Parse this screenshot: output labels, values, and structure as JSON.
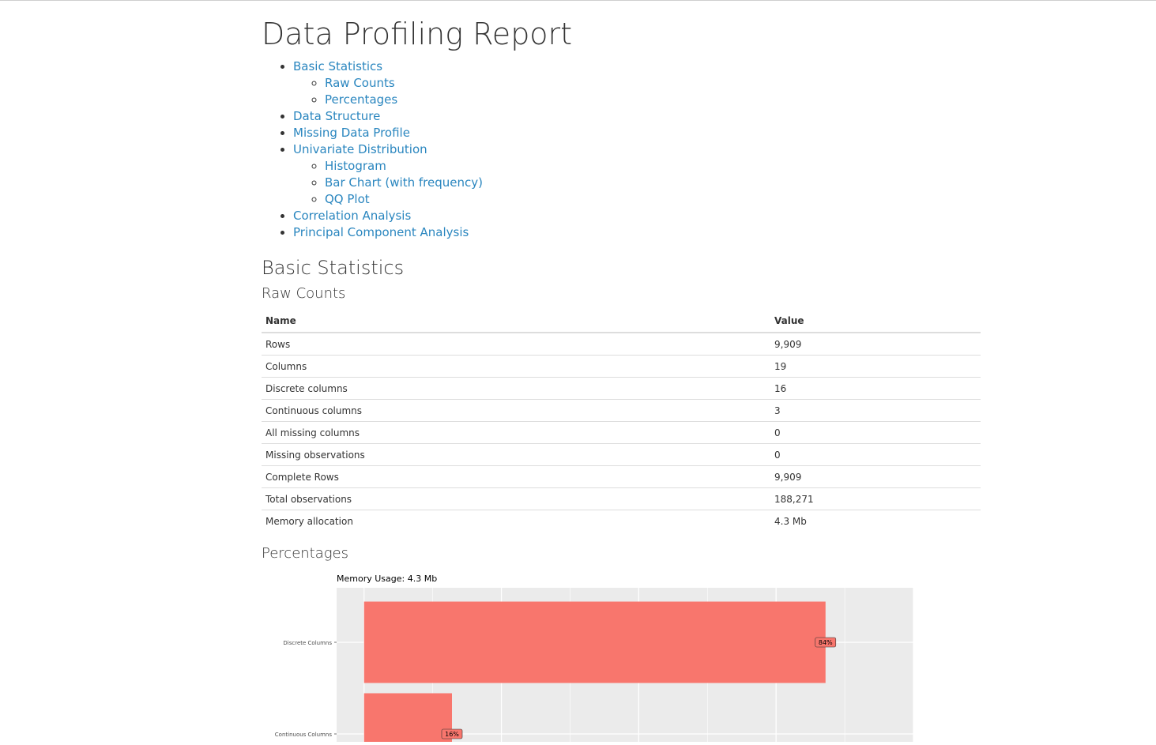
{
  "page": {
    "title": "Data Profiling Report"
  },
  "toc": [
    {
      "label": "Basic Statistics",
      "children": [
        "Raw Counts",
        "Percentages"
      ]
    },
    {
      "label": "Data Structure",
      "children": []
    },
    {
      "label": "Missing Data Profile",
      "children": []
    },
    {
      "label": "Univariate Distribution",
      "children": [
        "Histogram",
        "Bar Chart (with frequency)",
        "QQ Plot"
      ]
    },
    {
      "label": "Correlation Analysis",
      "children": []
    },
    {
      "label": "Principal Component Analysis",
      "children": []
    }
  ],
  "basic_statistics": {
    "heading": "Basic Statistics",
    "raw_counts": {
      "heading": "Raw Counts",
      "columns": [
        "Name",
        "Value"
      ],
      "rows": [
        [
          "Rows",
          "9,909"
        ],
        [
          "Columns",
          "19"
        ],
        [
          "Discrete columns",
          "16"
        ],
        [
          "Continuous columns",
          "3"
        ],
        [
          "All missing columns",
          "0"
        ],
        [
          "Missing observations",
          "0"
        ],
        [
          "Complete Rows",
          "9,909"
        ],
        [
          "Total observations",
          "188,271"
        ],
        [
          "Memory allocation",
          "4.3 Mb"
        ]
      ]
    },
    "percentages": {
      "heading": "Percentages"
    }
  },
  "chart_data": {
    "type": "bar",
    "orientation": "horizontal",
    "title": "Memory Usage: 4.3 Mb",
    "categories": [
      "Discrete Columns",
      "Continuous Columns"
    ],
    "values": [
      0.84,
      0.16
    ],
    "labels": [
      "84%",
      "16%"
    ],
    "bar_color": "#F8766D",
    "panel_color": "#EBEBEB",
    "grid": true,
    "xlim": [
      0,
      1.05
    ]
  },
  "colors": {
    "link": "#2a86bf",
    "text": "#333333"
  }
}
